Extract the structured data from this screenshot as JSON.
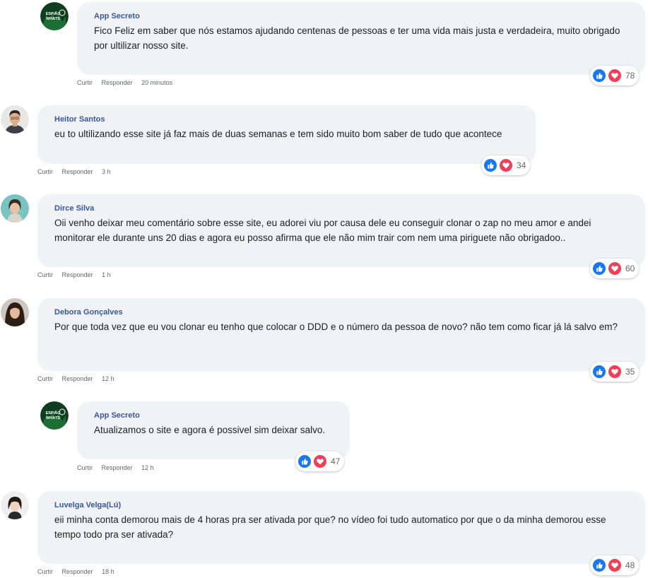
{
  "comments": [
    {
      "author": "App Secreto",
      "text": "Fico Feliz em saber que nós estamos ajudando centenas de pessoas e ter uma vida mais justa e verdadeira, muito obrigado por ultilizar nosso site.",
      "like": "Curtir",
      "reply": "Responder",
      "time": "20 minutos",
      "count": "78",
      "avatar": "logo",
      "logo_line1": "ESPIÃO",
      "logo_line2": "WHATS"
    },
    {
      "author": "Heitor Santos",
      "text": "eu to ultilizando esse site já faz mais de duas semanas e tem sido muito bom saber de tudo que acontece",
      "like": "Curtir",
      "reply": "Responder",
      "time": "3 h",
      "count": "34",
      "avatar": "man"
    },
    {
      "author": "Dirce Silva",
      "text": "Oii venho deixar meu comentário sobre esse site, eu adorei viu por causa dele eu conseguir clonar o zap no meu amor e andei monitorar ele durante uns 20 dias e agora eu posso afirma que ele não mim trair com nem uma piriguete não obrigadoo..",
      "like": "Curtir",
      "reply": "Responder",
      "time": "1 h",
      "count": "60",
      "avatar": "woman-teal"
    },
    {
      "author": "Debora Gonçalves",
      "text": "Por que toda vez que eu vou clonar eu tenho que colocar o DDD e o número da pessoa de novo? não tem como ficar já lá salvo em?",
      "like": "Curtir",
      "reply": "Responder",
      "time": "12 h",
      "count": "35",
      "avatar": "woman-dark"
    },
    {
      "author": "App Secreto",
      "text": "Atualizamos o site e agora é possivel sim deixar salvo.",
      "like": "Curtir",
      "reply": "Responder",
      "time": "12 h",
      "count": "47",
      "avatar": "logo",
      "logo_line1": "ESPIÃO",
      "logo_line2": "WHATS"
    },
    {
      "author": "Luvelga Velga(Lú)",
      "text": "eii minha conta demorou mais de 4 horas pra ser ativada por que? no vídeo foi tudo automatico por que o da minha demorou esse tempo todo pra ser ativada?",
      "like": "Curtir",
      "reply": "Responder",
      "time": "18 h",
      "count": "48",
      "avatar": "girl-light"
    }
  ],
  "colors": {
    "bubble": "#f0f2f5",
    "name": "#385898",
    "like": "#1877f2",
    "love": "#f33e58",
    "logo_bg": "#0f3d1f"
  }
}
